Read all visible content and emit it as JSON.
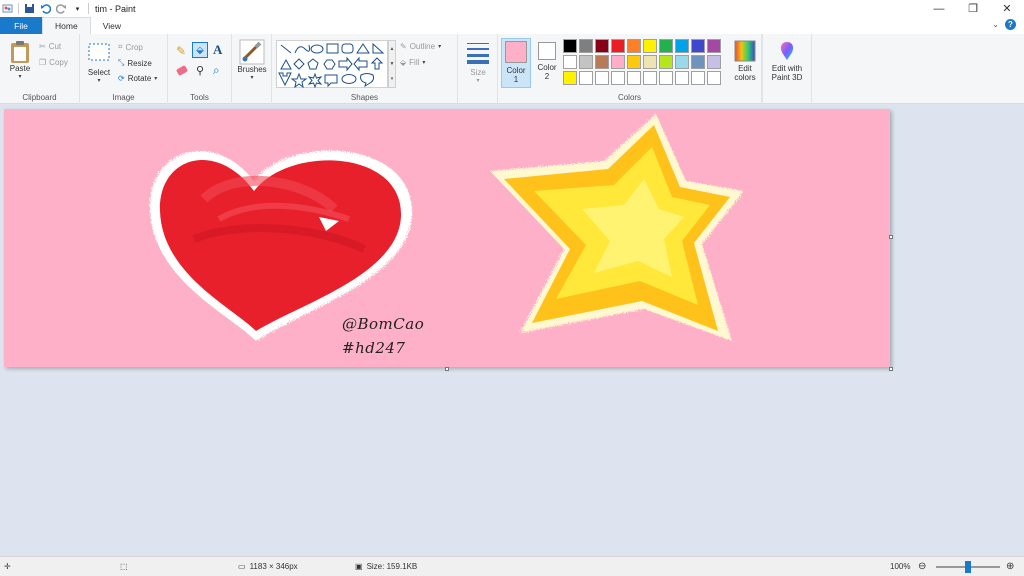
{
  "app": {
    "title": "tim - Paint",
    "window_controls": [
      "—",
      "❐",
      "✕"
    ]
  },
  "tabs": [
    {
      "label": "File"
    },
    {
      "label": "Home"
    },
    {
      "label": "View"
    }
  ],
  "ribbon": {
    "clipboard": {
      "label": "Clipboard",
      "paste": "Paste",
      "cut": "Cut",
      "copy": "Copy"
    },
    "image": {
      "label": "Image",
      "select": "Select",
      "crop": "Crop",
      "resize": "Resize",
      "rotate": "Rotate"
    },
    "tools": {
      "label": "Tools"
    },
    "brushes": {
      "label": "Brushes"
    },
    "shapes": {
      "label": "Shapes",
      "outline": "Outline",
      "fill": "Fill"
    },
    "size": {
      "label": "Size"
    },
    "colors": {
      "label": "Colors",
      "color1": "Color\n1",
      "color2": "Color\n2",
      "color1_value": "#fdb0c8",
      "color2_value": "#ffffff",
      "edit_colors": "Edit\ncolors",
      "paint3d": "Edit with\nPaint 3D",
      "palette": [
        "#000000",
        "#7f7f7f",
        "#880015",
        "#ed1c24",
        "#ff7f27",
        "#fff200",
        "#22b14c",
        "#00a2e8",
        "#3f48cc",
        "#a349a4",
        "#ffffff",
        "#c3c3c3",
        "#b97a57",
        "#ffaec9",
        "#ffc90e",
        "#efe4b0",
        "#b5e61d",
        "#99d9ea",
        "#7092be",
        "#c8bfe7",
        "#fff200",
        "#ffffff",
        "#ffffff",
        "#ffffff",
        "#ffffff",
        "#ffffff",
        "#ffffff",
        "#ffffff",
        "#ffffff",
        "#ffffff"
      ]
    }
  },
  "canvas": {
    "background": "#fdb0c8",
    "signature_line1": "@BomCao",
    "signature_line2": "#hd247"
  },
  "status": {
    "dimensions": "1183 × 346px",
    "size": "Size: 159.1KB",
    "zoom": "100%"
  }
}
